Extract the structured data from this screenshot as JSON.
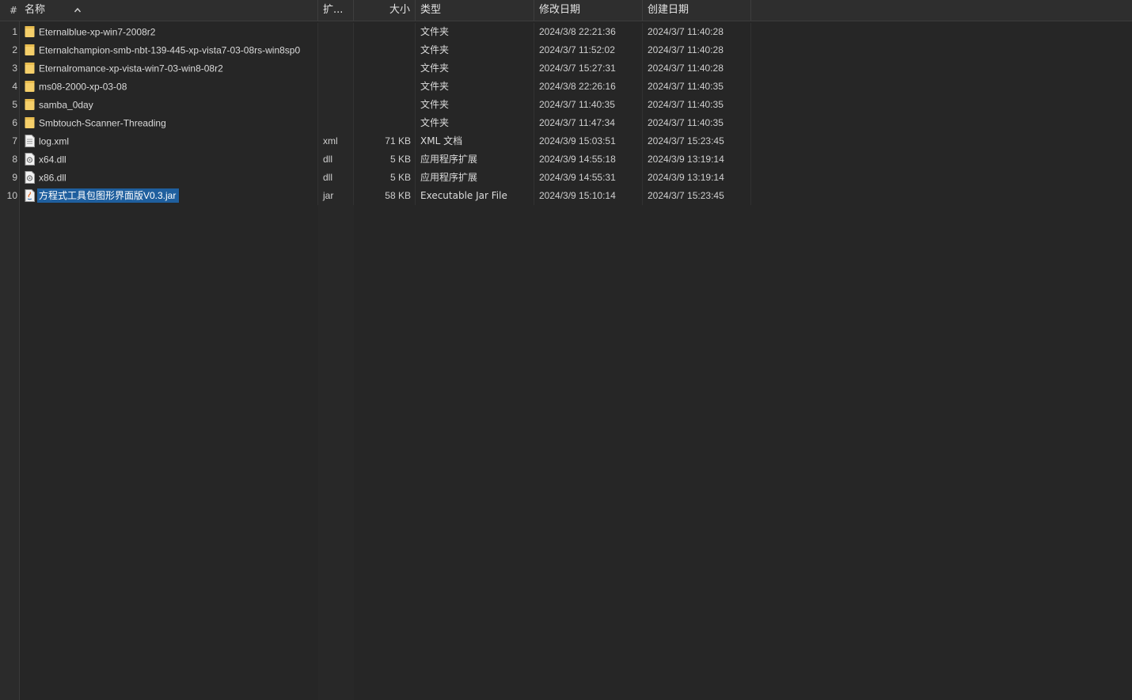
{
  "header": {
    "hash": "#",
    "name": "名称",
    "ext": "扩...",
    "size": "大小",
    "type": "类型",
    "modified": "修改日期",
    "created": "创建日期"
  },
  "files": [
    {
      "num": "1",
      "name": "Eternalblue-xp-win7-2008r2",
      "ext": "",
      "size": "",
      "type": "文件夹",
      "modified": "2024/3/8 22:21:36",
      "created": "2024/3/7 11:40:28",
      "icon": "folder-icon"
    },
    {
      "num": "2",
      "name": "Eternalchampion-smb-nbt-139-445-xp-vista7-03-08rs-win8sp0",
      "ext": "",
      "size": "",
      "type": "文件夹",
      "modified": "2024/3/7 11:52:02",
      "created": "2024/3/7 11:40:28",
      "icon": "folder-icon"
    },
    {
      "num": "3",
      "name": "Eternalromance-xp-vista-win7-03-win8-08r2",
      "ext": "",
      "size": "",
      "type": "文件夹",
      "modified": "2024/3/7 15:27:31",
      "created": "2024/3/7 11:40:28",
      "icon": "folder-icon"
    },
    {
      "num": "4",
      "name": "ms08-2000-xp-03-08",
      "ext": "",
      "size": "",
      "type": "文件夹",
      "modified": "2024/3/8 22:26:16",
      "created": "2024/3/7 11:40:35",
      "icon": "folder-icon"
    },
    {
      "num": "5",
      "name": "samba_0day",
      "ext": "",
      "size": "",
      "type": "文件夹",
      "modified": "2024/3/7 11:40:35",
      "created": "2024/3/7 11:40:35",
      "icon": "folder-icon"
    },
    {
      "num": "6",
      "name": "Smbtouch-Scanner-Threading",
      "ext": "",
      "size": "",
      "type": "文件夹",
      "modified": "2024/3/7 11:47:34",
      "created": "2024/3/7 11:40:35",
      "icon": "folder-icon"
    },
    {
      "num": "7",
      "name": "log.xml",
      "ext": "xml",
      "size": "71 KB",
      "type": "XML 文档",
      "modified": "2024/3/9 15:03:51",
      "created": "2024/3/7 15:23:45",
      "icon": "document-icon"
    },
    {
      "num": "8",
      "name": "x64.dll",
      "ext": "dll",
      "size": "5 KB",
      "type": "应用程序扩展",
      "modified": "2024/3/9 14:55:18",
      "created": "2024/3/9 13:19:14",
      "icon": "dll-icon"
    },
    {
      "num": "9",
      "name": "x86.dll",
      "ext": "dll",
      "size": "5 KB",
      "type": "应用程序扩展",
      "modified": "2024/3/9 14:55:31",
      "created": "2024/3/9 13:19:14",
      "icon": "dll-icon"
    },
    {
      "num": "10",
      "name": "方程式工具包图形界面版V0.3.jar",
      "ext": "jar",
      "size": "58 KB",
      "type": "Executable Jar File",
      "modified": "2024/3/9 15:10:14",
      "created": "2024/3/7 15:23:45",
      "icon": "java-jar-icon",
      "selected": true
    }
  ],
  "colors": {
    "background": "#262626",
    "folder": "#f5cf6a",
    "selection": "#1f5f9e"
  }
}
